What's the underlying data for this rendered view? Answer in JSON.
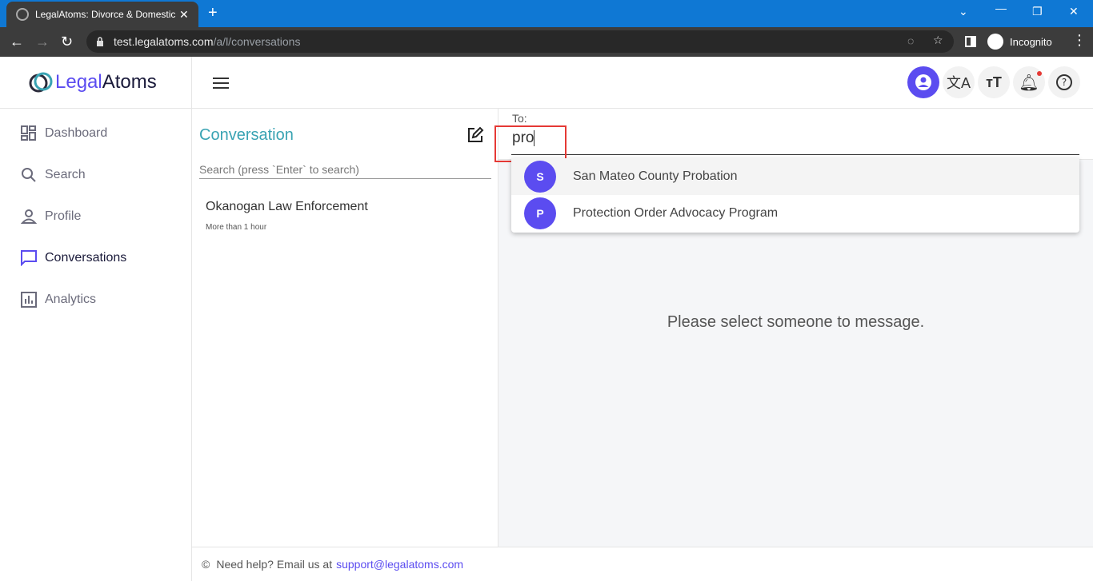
{
  "browser": {
    "tab_title": "LegalAtoms: Divorce & Domestic",
    "url_host": "test.legalatoms.com",
    "url_path": "/a/l/conversations",
    "incognito_label": "Incognito"
  },
  "brand": {
    "part1": "Legal",
    "part2": "Atoms"
  },
  "sidebar": {
    "items": [
      {
        "label": "Dashboard",
        "icon": "dashboard-icon"
      },
      {
        "label": "Search",
        "icon": "search-icon"
      },
      {
        "label": "Profile",
        "icon": "person-icon"
      },
      {
        "label": "Conversations",
        "icon": "chat-icon"
      },
      {
        "label": "Analytics",
        "icon": "analytics-icon"
      }
    ],
    "active": "Conversations"
  },
  "conversations": {
    "title": "Conversation",
    "search_placeholder": "Search (press `Enter` to search)",
    "items": [
      {
        "name": "Okanogan Law Enforcement",
        "time": "More than 1 hour"
      }
    ]
  },
  "compose": {
    "to_label": "To:",
    "to_value": "pro",
    "suggestions": [
      {
        "initial": "S",
        "name": "San Mateo County Probation"
      },
      {
        "initial": "P",
        "name": "Protection Order Advocacy Program"
      }
    ],
    "empty_message": "Please select someone to message."
  },
  "footer": {
    "copyright": "©",
    "help_text": "Need help? Email us at",
    "email": "support@legalatoms.com"
  },
  "colors": {
    "accent": "#5b4cf0",
    "title_teal": "#39a3b3",
    "chrome_blue": "#0f78d4",
    "highlight_red": "#e53935",
    "notification_dot": "#e53935"
  }
}
